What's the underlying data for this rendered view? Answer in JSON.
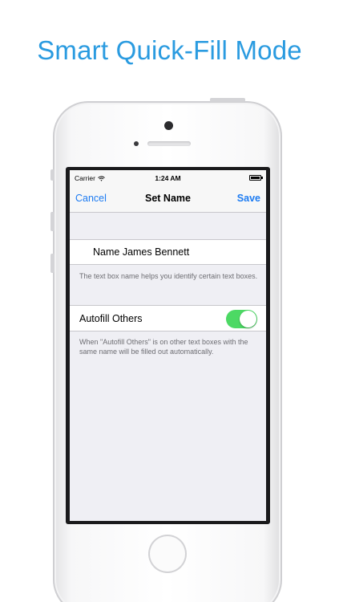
{
  "headline": "Smart Quick-Fill Mode",
  "status_bar": {
    "carrier": "Carrier",
    "time": "1:24 AM",
    "wifi_icon": "wifi-icon",
    "battery_icon": "battery-icon"
  },
  "nav": {
    "cancel_label": "Cancel",
    "title": "Set Name",
    "save_label": "Save",
    "accent": "#1e7cf2"
  },
  "name_field": {
    "value": "Name James Bennett"
  },
  "name_note": "The text box name helps you identify certain text boxes.",
  "autofill": {
    "label": "Autofill Others",
    "enabled": true,
    "on_color": "#4cd964"
  },
  "autofill_note": "When \"Autofill Others\" is on other text boxes with the same name will be filled out automatically.",
  "headline_color": "#2a9be0"
}
